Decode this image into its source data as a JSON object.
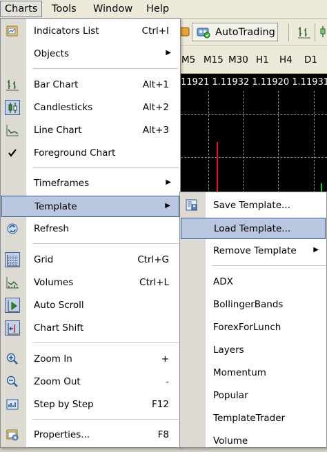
{
  "menubar": {
    "items": [
      {
        "label": "Charts",
        "active": true
      },
      {
        "label": "Tools"
      },
      {
        "label": "Window"
      },
      {
        "label": "Help"
      }
    ]
  },
  "toolbar": {
    "autotrading_label": "AutoTrading"
  },
  "timeframes": [
    "M5",
    "M15",
    "M30",
    "H1",
    "H4",
    "D1"
  ],
  "chart": {
    "prices": "11921 1.11932 1.11920 1.11931"
  },
  "charts_menu": {
    "items": [
      {
        "label": "Indicators List",
        "shortcut": "Ctrl+I",
        "icon": "indicators-list-icon"
      },
      {
        "label": "Objects",
        "submenu": true
      },
      {
        "label": "Bar Chart",
        "shortcut": "Alt+1",
        "icon": "bar-chart-icon"
      },
      {
        "label": "Candlesticks",
        "shortcut": "Alt+2",
        "icon": "candlesticks-icon"
      },
      {
        "label": "Line Chart",
        "shortcut": "Alt+3",
        "icon": "line-chart-icon"
      },
      {
        "label": "Foreground Chart",
        "icon": "checkmark-icon"
      },
      {
        "label": "Timeframes",
        "submenu": true
      },
      {
        "label": "Template",
        "submenu": true,
        "highlighted": true
      },
      {
        "label": "Refresh",
        "icon": "refresh-icon"
      },
      {
        "label": "Grid",
        "shortcut": "Ctrl+G",
        "icon": "grid-icon"
      },
      {
        "label": "Volumes",
        "shortcut": "Ctrl+L",
        "icon": "volumes-icon"
      },
      {
        "label": "Auto Scroll",
        "icon": "auto-scroll-icon"
      },
      {
        "label": "Chart Shift",
        "icon": "chart-shift-icon"
      },
      {
        "label": "Zoom In",
        "shortcut": "+",
        "icon": "zoom-in-icon"
      },
      {
        "label": "Zoom Out",
        "shortcut": "-",
        "icon": "zoom-out-icon"
      },
      {
        "label": "Step by Step",
        "shortcut": "F12",
        "icon": "step-by-step-icon"
      },
      {
        "label": "Properties...",
        "shortcut": "F8",
        "icon": "properties-icon"
      }
    ]
  },
  "template_menu": {
    "items": [
      {
        "label": "Save Template...",
        "icon": "save-template-icon"
      },
      {
        "label": "Load Template...",
        "highlighted": true
      },
      {
        "label": "Remove Template",
        "submenu": true
      },
      {
        "label": "ADX"
      },
      {
        "label": "BollingerBands"
      },
      {
        "label": "ForexForLunch"
      },
      {
        "label": "Layers"
      },
      {
        "label": "Momentum"
      },
      {
        "label": "Popular"
      },
      {
        "label": "TemplateTrader"
      },
      {
        "label": "Volume"
      }
    ]
  },
  "colors": {
    "highlight_bg": "#b8c6df",
    "highlight_border": "#3c5a96",
    "chart_bg": "#000000",
    "bull_candle": "#11cc11",
    "bear_candle": "#ee1111"
  }
}
